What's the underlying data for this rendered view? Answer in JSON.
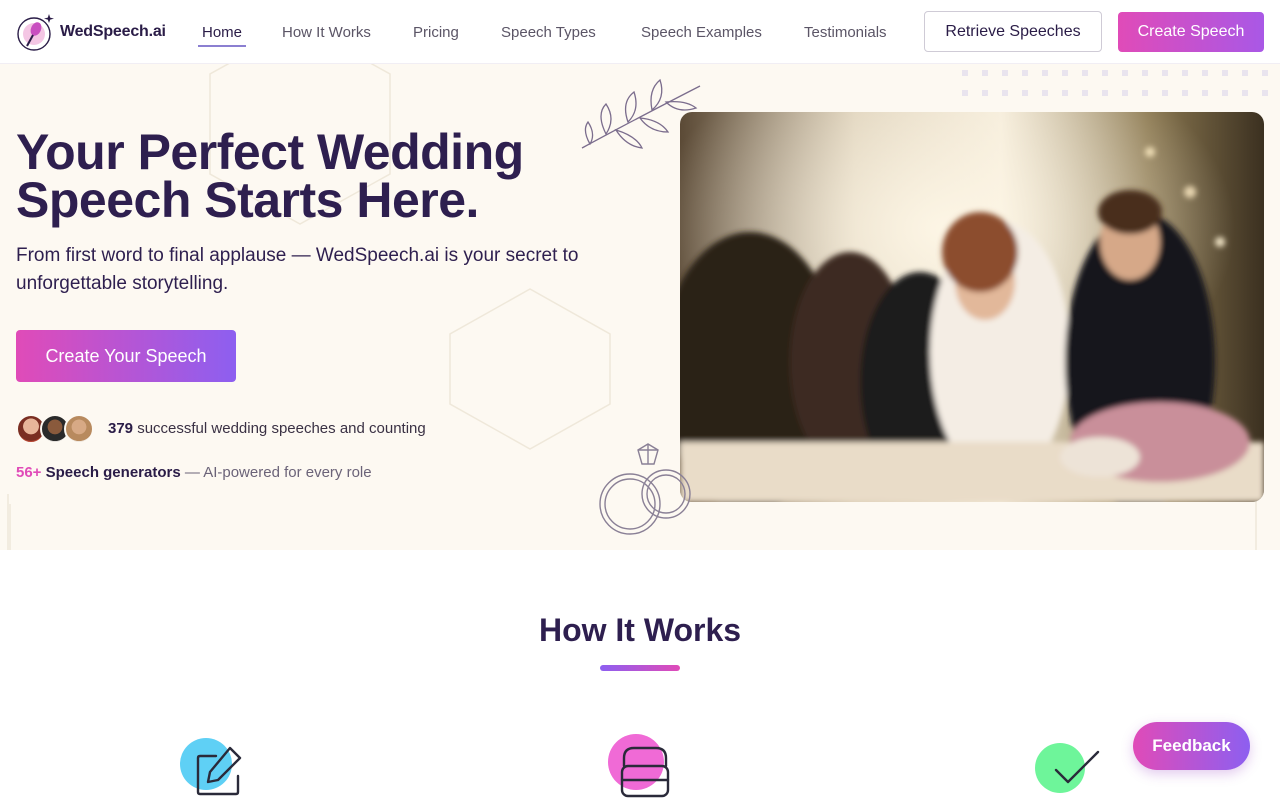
{
  "brand": {
    "name": "WedSpeech.ai",
    "logo_icon": "microphone-sparkle-icon",
    "colors": {
      "primary_dark": "#2e1f4f",
      "accent_pink": "#e04bb8",
      "accent_purple": "#8d5ff0",
      "hero_bg": "#fdf9f2"
    }
  },
  "nav": {
    "links": [
      {
        "label": "Home",
        "active": true
      },
      {
        "label": "How It Works",
        "active": false
      },
      {
        "label": "Pricing",
        "active": false
      },
      {
        "label": "Speech Types",
        "active": false
      },
      {
        "label": "Speech Examples",
        "active": false
      },
      {
        "label": "Testimonials",
        "active": false
      }
    ],
    "retrieve_label": "Retrieve Speeches",
    "create_label": "Create Speech"
  },
  "hero": {
    "title": "Your Perfect Wedding Speech Starts Here.",
    "subtitle": "From first word to final applause — WedSpeech.ai is your secret to unforgettable storytelling.",
    "cta_label": "Create Your Speech",
    "speech_count": "379",
    "speech_count_text": "successful wedding speeches and counting",
    "generators_count": "56+",
    "generators_label": "Speech generators",
    "generators_suffix": "— AI-powered for every role",
    "photo": "wedding-reception-toast-photo"
  },
  "how_it_works": {
    "title": "How It Works",
    "steps": [
      {
        "icon": "edit-pencil-icon"
      },
      {
        "icon": "layers-stack-icon"
      },
      {
        "icon": "checkmark-icon"
      }
    ]
  },
  "feedback": {
    "label": "Feedback"
  }
}
